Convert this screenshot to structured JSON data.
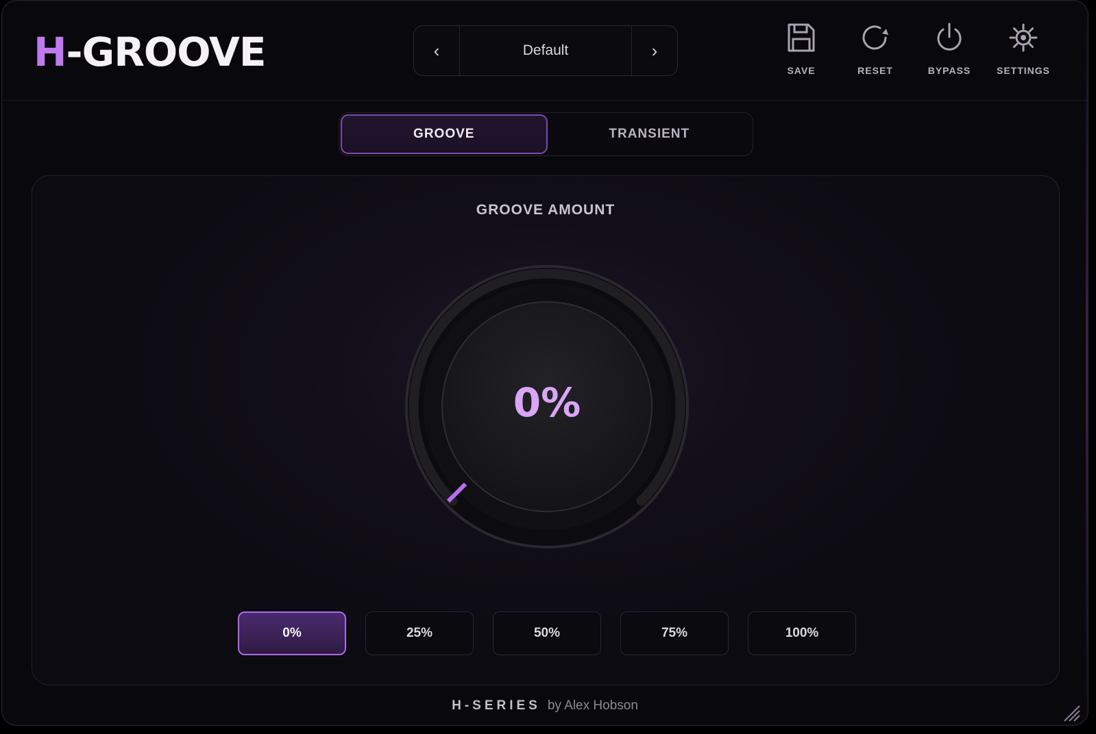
{
  "logo": {
    "prefix": "H",
    "rest": "-GROOVE"
  },
  "preset": {
    "name": "Default",
    "prev_label": "‹",
    "next_label": "›"
  },
  "toolbar": {
    "save": {
      "label": "SAVE",
      "icon": "save-icon"
    },
    "reset": {
      "label": "RESET",
      "icon": "reset-icon"
    },
    "bypass": {
      "label": "BYPASS",
      "icon": "power-icon"
    },
    "settings": {
      "label": "SETTINGS",
      "icon": "gear-icon"
    }
  },
  "tabs": [
    {
      "label": "GROOVE",
      "active": true
    },
    {
      "label": "TRANSIENT",
      "active": false
    }
  ],
  "groove": {
    "title": "GROOVE AMOUNT",
    "value_text": "0%",
    "value": 0,
    "amounts": [
      "0%",
      "25%",
      "50%",
      "75%",
      "100%"
    ],
    "selected_amount": "0%"
  },
  "footer": {
    "series": "H-SERIES",
    "author": "by Alex Hobson"
  },
  "colors": {
    "accent": "#c07af0",
    "accent_dark": "#7d4ab0",
    "knob_value": "#d9a6f6",
    "background": "#09080d"
  }
}
